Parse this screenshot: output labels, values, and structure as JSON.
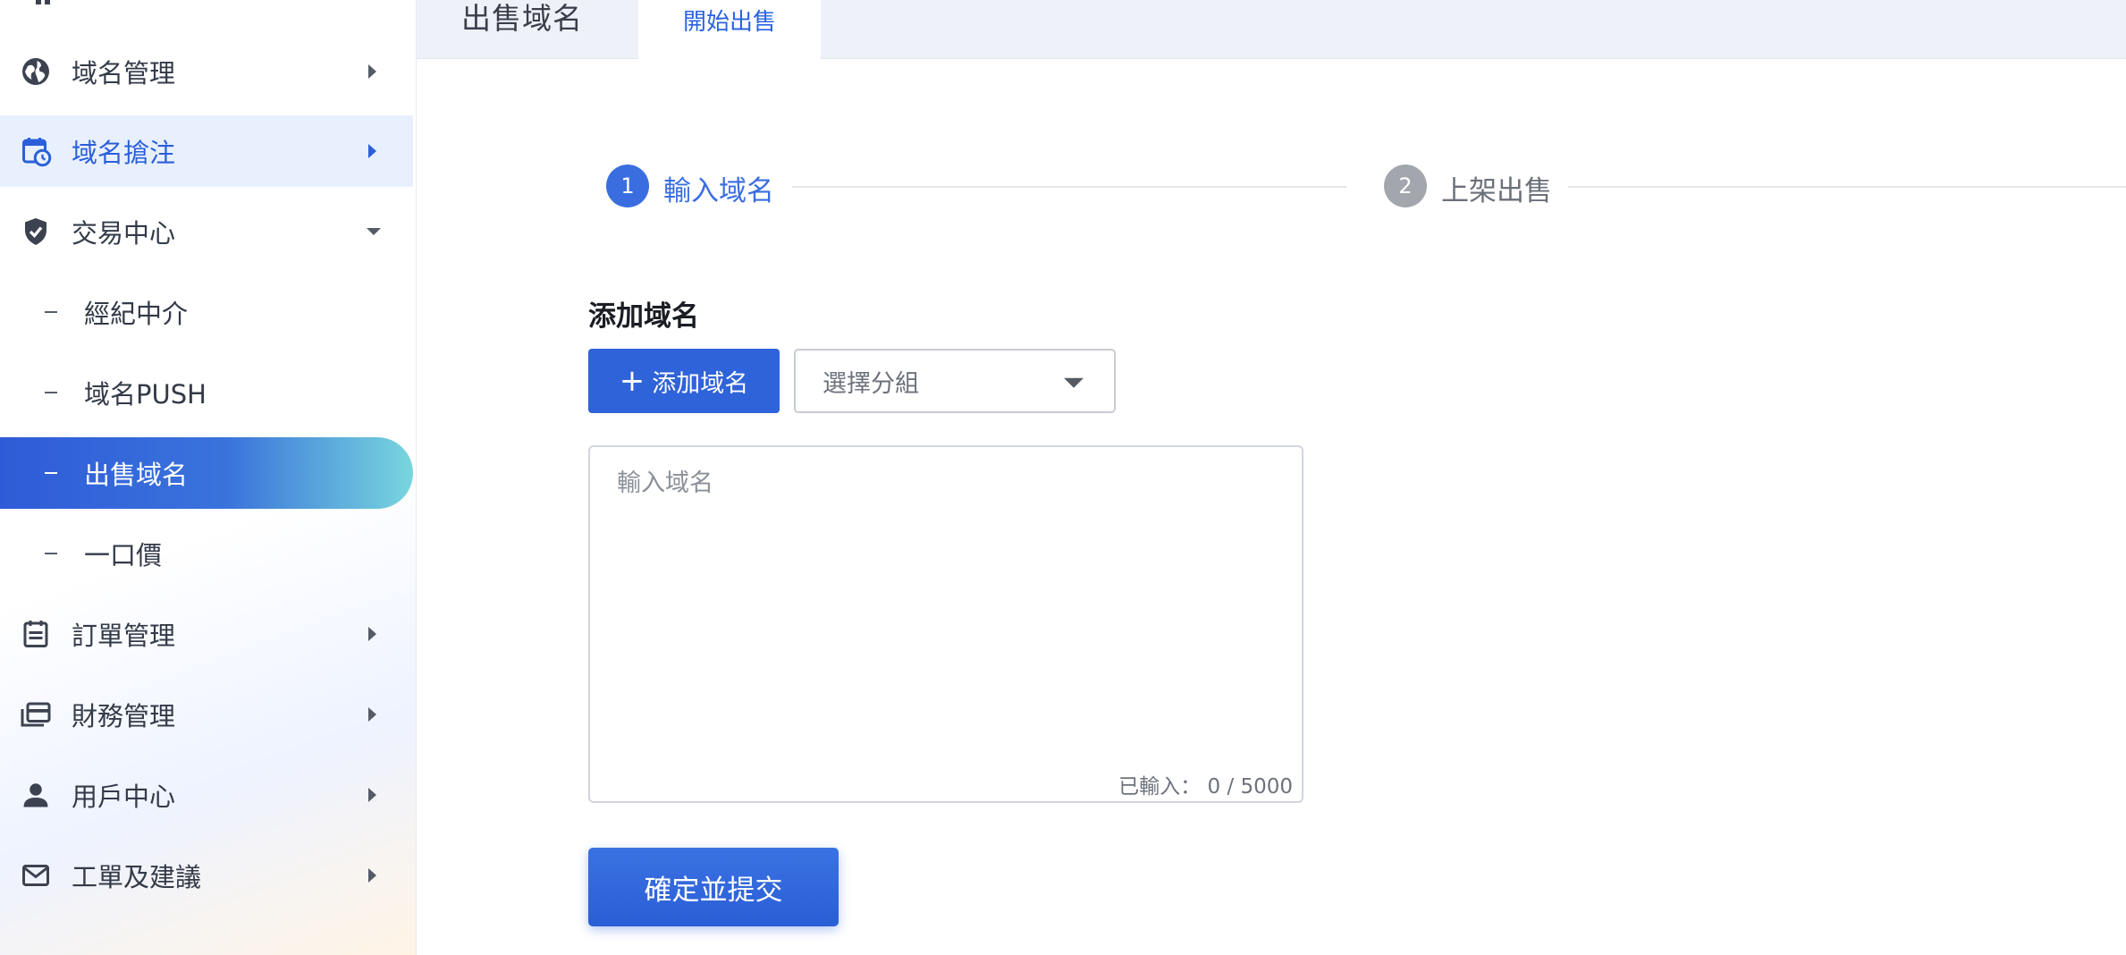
{
  "sidebar": {
    "items": [
      {
        "label": "域名管理",
        "icon": "globe-icon"
      },
      {
        "label": "域名搶注",
        "icon": "calendar-clock-icon"
      },
      {
        "label": "交易中心",
        "icon": "shield-check-icon"
      },
      {
        "label": "訂單管理",
        "icon": "order-list-icon"
      },
      {
        "label": "財務管理",
        "icon": "wallet-icon"
      },
      {
        "label": "用戶中心",
        "icon": "user-icon"
      },
      {
        "label": "工單及建議",
        "icon": "mail-icon"
      }
    ],
    "subitems": [
      {
        "label": "經紀中介"
      },
      {
        "label": "域名PUSH"
      },
      {
        "label": "出售域名"
      },
      {
        "label": "一口價"
      }
    ],
    "colors": {
      "accent": "#2f5bd8",
      "gradient_end": "#78d6dd",
      "active_bg": "#e9f0fd"
    }
  },
  "tabs": {
    "page_title": "出售域名",
    "active_tab": "開始出售"
  },
  "steps": [
    {
      "number": "1",
      "label": "輸入域名",
      "state": "active"
    },
    {
      "number": "2",
      "label": "上架出售",
      "state": "pending"
    }
  ],
  "form": {
    "section_title": "添加域名",
    "add_button_label": "添加域名",
    "group_select_value": "選擇分組",
    "textarea_placeholder": "輸入域名",
    "counter_text": "已輸入： 0 / 5000",
    "submit_label": "確定並提交"
  }
}
